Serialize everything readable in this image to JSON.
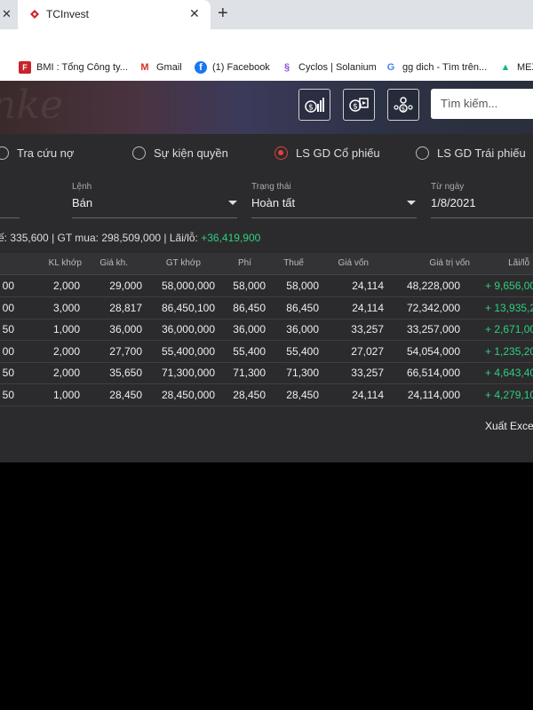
{
  "browser": {
    "tab_title": "TCInvest",
    "bookmarks": [
      "BMI : Tổng Công ty...",
      "Gmail",
      "(1) Facebook",
      "Cyclos | Solanium",
      "gg dich - Tìm trên...",
      "MEX"
    ]
  },
  "header": {
    "search_placeholder": "Tìm kiếm..."
  },
  "radios": [
    {
      "label": "Tra cứu nợ",
      "selected": false
    },
    {
      "label": "Sự kiện quyền",
      "selected": false
    },
    {
      "label": "LS GD Cổ phiếu",
      "selected": true
    },
    {
      "label": "LS GD Trái phiếu",
      "selected": false
    }
  ],
  "filters": {
    "order_label": "Lệnh",
    "order_value": "Bán",
    "status_label": "Trạng thái",
    "status_value": "Hoàn tất",
    "from_label": "Từ ngày",
    "from_value": "1/8/2021"
  },
  "summary": {
    "sell_fragment": "ế: 335,600",
    "buy_label": "GT mua:",
    "buy_value": "298,509,000",
    "pl_label": "Lãi/lỗ:",
    "pl_value": "+36,419,900"
  },
  "table": {
    "columns": [
      "KL khớp",
      "Giá kh.",
      "GT khớp",
      "Phí",
      "Thuế",
      "Giá vốn",
      "Giá trị vốn",
      "Lãi/lỗ"
    ],
    "rows": [
      {
        "c0": "00",
        "qty": "2,000",
        "price": "29,000",
        "value": "58,000,000",
        "fee": "58,000",
        "tax": "58,000",
        "cost": "24,114",
        "cost_value": "48,228,000",
        "pl": "+ 9,656,00"
      },
      {
        "c0": "00",
        "qty": "3,000",
        "price": "28,817",
        "value": "86,450,100",
        "fee": "86,450",
        "tax": "86,450",
        "cost": "24,114",
        "cost_value": "72,342,000",
        "pl": "+ 13,935,20"
      },
      {
        "c0": "50",
        "qty": "1,000",
        "price": "36,000",
        "value": "36,000,000",
        "fee": "36,000",
        "tax": "36,000",
        "cost": "33,257",
        "cost_value": "33,257,000",
        "pl": "+ 2,671,00"
      },
      {
        "c0": "00",
        "qty": "2,000",
        "price": "27,700",
        "value": "55,400,000",
        "fee": "55,400",
        "tax": "55,400",
        "cost": "27,027",
        "cost_value": "54,054,000",
        "pl": "+ 1,235,20"
      },
      {
        "c0": "50",
        "qty": "2,000",
        "price": "35,650",
        "value": "71,300,000",
        "fee": "71,300",
        "tax": "71,300",
        "cost": "33,257",
        "cost_value": "66,514,000",
        "pl": "+ 4,643,40"
      },
      {
        "c0": "50",
        "qty": "1,000",
        "price": "28,450",
        "value": "28,450,000",
        "fee": "28,450",
        "tax": "28,450",
        "cost": "24,114",
        "cost_value": "24,114,000",
        "pl": "+ 4,279,10"
      }
    ]
  },
  "export_label": "Xuất Exce",
  "colors": {
    "accent_red": "#e0413c",
    "positive": "#2ecf7e",
    "panel": "#2b2b2d"
  }
}
